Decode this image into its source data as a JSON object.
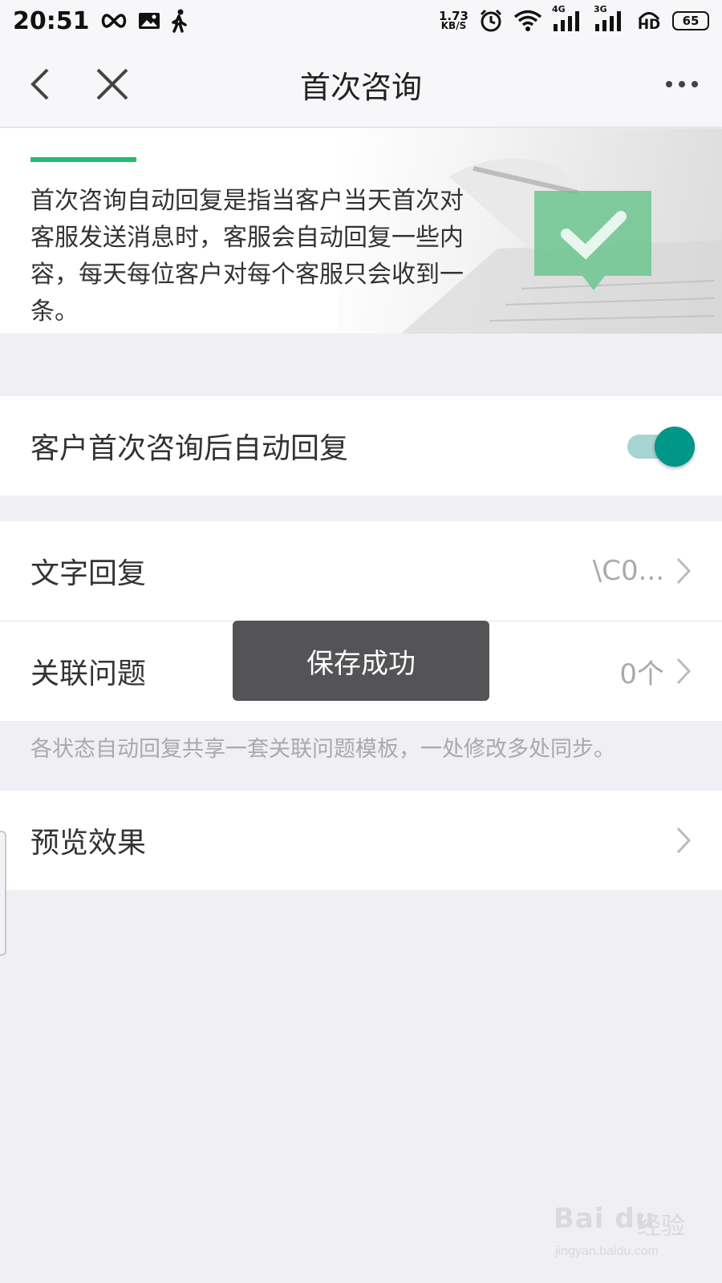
{
  "status_bar": {
    "time": "20:51",
    "net_speed_value": "1.73",
    "net_speed_unit": "KB/S",
    "signal_4g": "4G",
    "signal_3g": "3G",
    "hd": "HD",
    "battery": "65"
  },
  "nav": {
    "title": "首次咨询"
  },
  "banner": {
    "description": "首次咨询自动回复是指当客户当天首次对客服发送消息时，客服会自动回复一些内容，每天每位客户对每个客服只会收到一条。"
  },
  "auto_reply_toggle": {
    "label": "客户首次咨询后自动回复",
    "enabled": true,
    "accent_color": "#009688"
  },
  "text_reply": {
    "label": "文字回复",
    "value": "\\C0..."
  },
  "related_questions": {
    "label": "关联问题",
    "value": "0个"
  },
  "note": "各状态自动回复共享一套关联问题模板，一处修改多处同步。",
  "preview": {
    "label": "预览效果"
  },
  "toast": {
    "message": "保存成功"
  },
  "watermark": {
    "logo": "Bai du",
    "text": "经验",
    "url": "jingyan.baidu.com"
  }
}
